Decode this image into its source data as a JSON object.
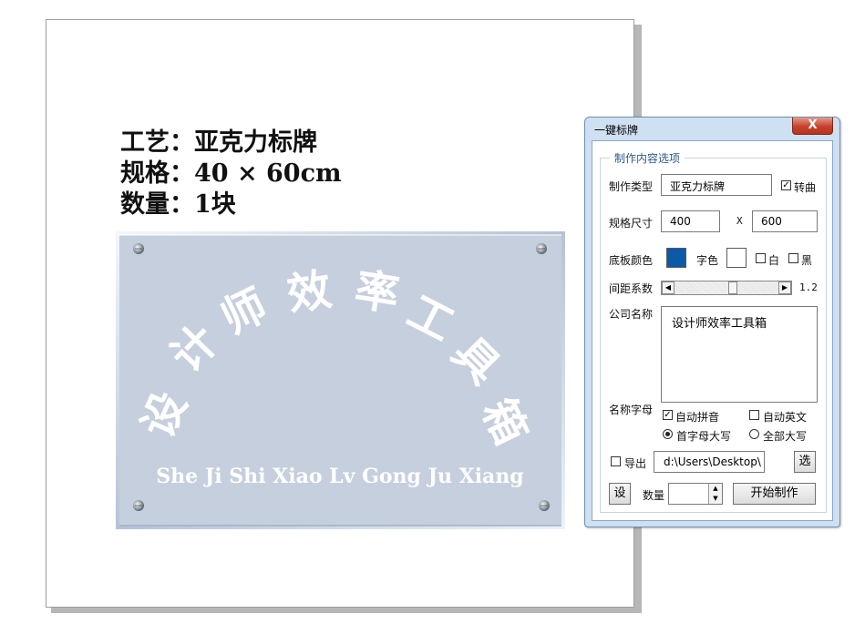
{
  "canvas": {
    "spec_lines": [
      "工艺：亚克力标牌",
      "规格：40 × 60cm",
      "数量：1块"
    ],
    "plate": {
      "arc_chars": [
        "设",
        "计",
        "师",
        "效",
        "率",
        "工",
        "具",
        "箱"
      ],
      "pinyin": "She Ji Shi Xiao Lv Gong Ju Xiang",
      "colors": {
        "plate": "#c6cfdd",
        "frame": "#e8eef6",
        "text": "#ffffff"
      }
    }
  },
  "dialog": {
    "title": "一键标牌",
    "close_label": "X",
    "group_title": "制作内容选项",
    "type": {
      "label": "制作类型",
      "value": "亚克力标牌",
      "curve_label": "转曲",
      "curve_checked": true
    },
    "size": {
      "label": "规格尺寸",
      "width": "400",
      "x_label": "X",
      "height": "600"
    },
    "color": {
      "label": "底板颜色",
      "board_color": "#0b5aa8",
      "font_color_label": "字色",
      "font_color": "#ffffff",
      "white_label": "白",
      "black_label": "黑"
    },
    "spacing": {
      "label": "间距系数",
      "value": "1.2"
    },
    "company": {
      "label": "公司名称",
      "value": "设计师效率工具箱"
    },
    "letters": {
      "label": "名称字母",
      "auto_pinyin_label": "自动拼音",
      "auto_pinyin_checked": true,
      "auto_english_label": "自动英文",
      "first_upper_label": "首字母大写",
      "all_upper_label": "全部大写"
    },
    "export": {
      "label": "导出",
      "path": "d:\\Users\\Desktop\\",
      "choose_label": "选"
    },
    "bottom": {
      "set_label": "设",
      "quantity_label": "数量",
      "quantity": "",
      "start_label": "开始制作"
    },
    "icons": [
      "close-icon",
      "checkbox-icon",
      "radio-icon",
      "scroll-left-icon",
      "scroll-right-icon",
      "spin-up-icon",
      "spin-down-icon",
      "screw-icon"
    ]
  }
}
